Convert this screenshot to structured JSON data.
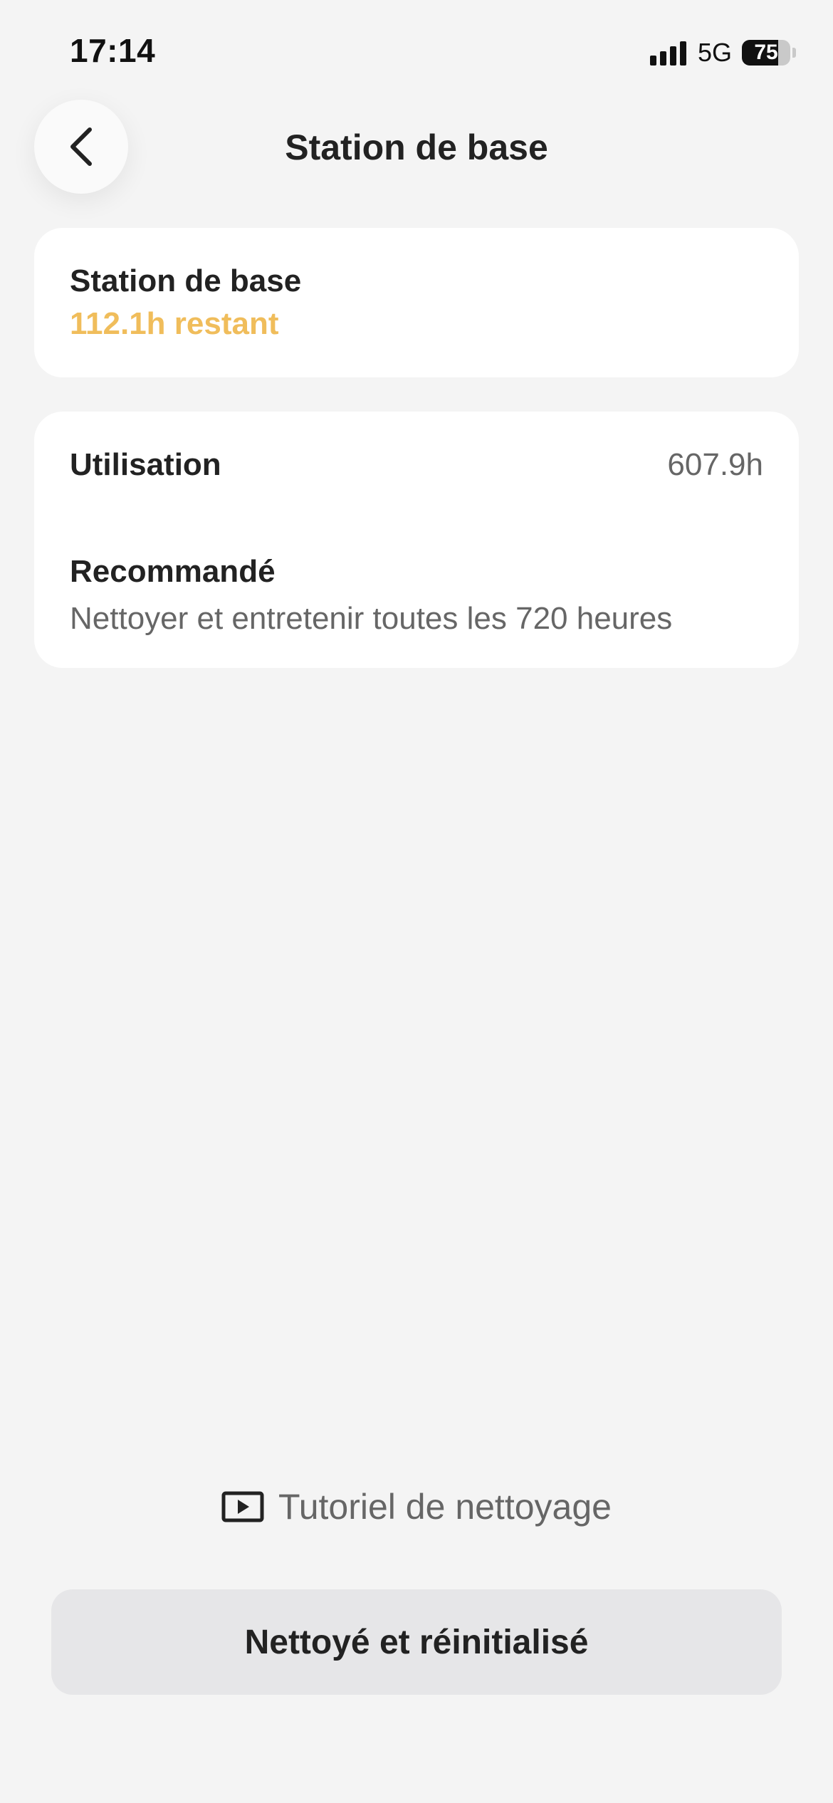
{
  "status_bar": {
    "time": "17:14",
    "network": "5G",
    "battery_percent": "75",
    "battery_level": 0.75,
    "signal_bars": 4
  },
  "header": {
    "title": "Station de base",
    "back_icon": "chevron-left-icon"
  },
  "status_card": {
    "title": "Station de base",
    "remaining": "112.1h restant",
    "remaining_color": "#f0bd5b"
  },
  "details_card": {
    "usage_label": "Utilisation",
    "usage_value": "607.9h",
    "recommended_label": "Recommandé",
    "recommended_text": "Nettoyer et entretenir toutes les 720 heures"
  },
  "tutorial": {
    "label": "Tutoriel de nettoyage",
    "icon": "play-video-icon"
  },
  "actions": {
    "reset_label": "Nettoyé et réinitialisé"
  }
}
